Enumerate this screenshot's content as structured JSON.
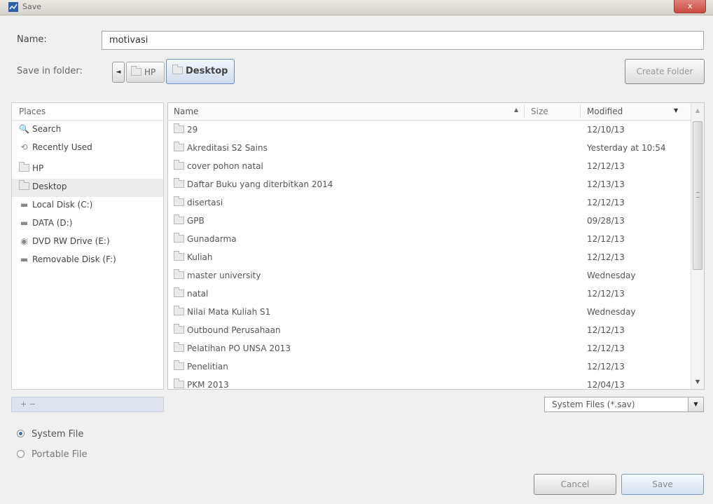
{
  "window": {
    "title": "Save",
    "close_label": "x"
  },
  "name_field": {
    "label": "Name:",
    "value": "motivasi"
  },
  "save_in": {
    "label": "Save in folder:",
    "back_arrow": "◄",
    "crumbs": [
      "HP",
      "Desktop"
    ],
    "selected_crumb": "Desktop"
  },
  "create_folder_label": "Create Folder",
  "places": {
    "header": "Places",
    "items": [
      {
        "label": "Search",
        "icon": "search-icon",
        "glyph": "🔍"
      },
      {
        "label": "Recently Used",
        "icon": "recent-icon",
        "glyph": "⟲"
      },
      {
        "label": "HP",
        "icon": "folder-icon",
        "glyph": ""
      },
      {
        "label": "Desktop",
        "icon": "folder-icon",
        "glyph": ""
      },
      {
        "label": "Local Disk (C:)",
        "icon": "drive-icon",
        "glyph": "▬"
      },
      {
        "label": "DATA (D:)",
        "icon": "drive-icon",
        "glyph": "▬"
      },
      {
        "label": "DVD RW Drive (E:)",
        "icon": "optical-drive-icon",
        "glyph": "◉"
      },
      {
        "label": "Removable Disk (F:)",
        "icon": "drive-icon",
        "glyph": "▬"
      }
    ],
    "selected": "Desktop",
    "add_remove": "+ −"
  },
  "files": {
    "columns": {
      "name": "Name",
      "size": "Size",
      "modified": "Modified"
    },
    "sort_arrow": "▲",
    "modified_arrow": "▼",
    "rows": [
      {
        "name": "29",
        "modified": "12/10/13"
      },
      {
        "name": "Akreditasi S2 Sains",
        "modified": "Yesterday at 10:54"
      },
      {
        "name": "cover pohon natal",
        "modified": "12/12/13"
      },
      {
        "name": "Daftar Buku yang diterbitkan 2014",
        "modified": "12/13/13"
      },
      {
        "name": "disertasi",
        "modified": "12/12/13"
      },
      {
        "name": "GPB",
        "modified": "09/28/13"
      },
      {
        "name": "Gunadarma",
        "modified": "12/12/13"
      },
      {
        "name": "Kuliah",
        "modified": "12/12/13"
      },
      {
        "name": "master university",
        "modified": "Wednesday"
      },
      {
        "name": "natal",
        "modified": "12/12/13"
      },
      {
        "name": "Nilai Mata Kuliah S1",
        "modified": "Wednesday"
      },
      {
        "name": "Outbound Perusahaan",
        "modified": "12/12/13"
      },
      {
        "name": "Pelatihan PO UNSA 2013",
        "modified": "12/12/13"
      },
      {
        "name": "Penelitian",
        "modified": "12/12/13"
      },
      {
        "name": "PKM 2013",
        "modified": "12/04/13"
      }
    ]
  },
  "filter": {
    "value": "System Files (*.sav)",
    "drop_arrow": "▼"
  },
  "radios": [
    {
      "label": "System File",
      "checked": true
    },
    {
      "label": "Portable File",
      "checked": false
    }
  ],
  "buttons": {
    "cancel": "Cancel",
    "save": "Save"
  }
}
